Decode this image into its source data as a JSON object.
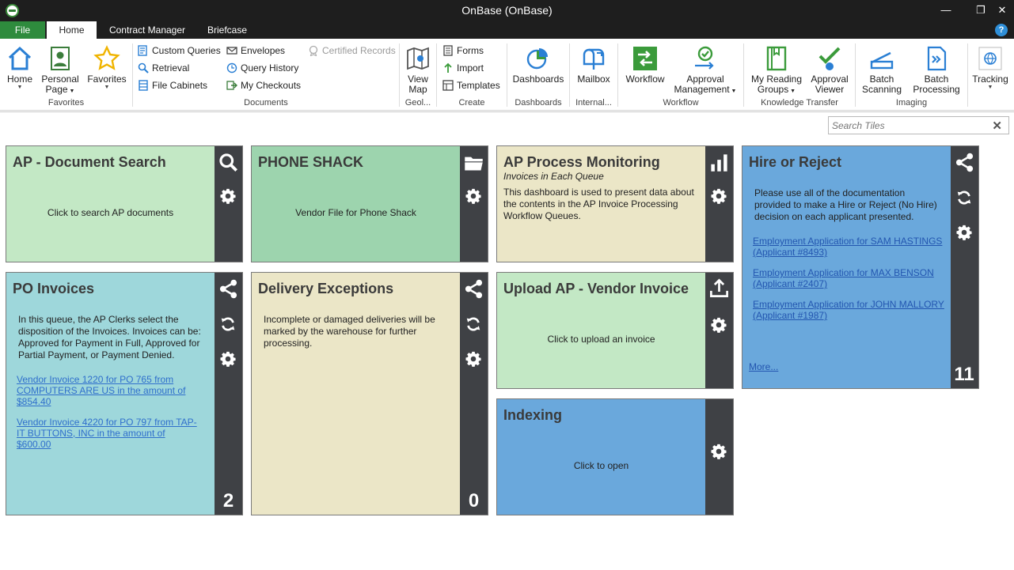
{
  "window": {
    "title": "OnBase (OnBase)",
    "minimize": "—",
    "restore": "❐",
    "close": "✕"
  },
  "tabs": {
    "file": "File",
    "home": "Home",
    "contract_manager": "Contract Manager",
    "briefcase": "Briefcase",
    "help": "?"
  },
  "ribbon": {
    "home": "Home",
    "personal_page": "Personal",
    "personal_page2": "Page",
    "favorites": "Favorites",
    "group_favorites": "Favorites",
    "custom_queries": "Custom Queries",
    "retrieval": "Retrieval",
    "file_cabinets": "File Cabinets",
    "envelopes": "Envelopes",
    "query_history": "Query History",
    "my_checkouts": "My Checkouts",
    "certified_records": "Certified Records",
    "group_documents": "Documents",
    "view_map": "View",
    "view_map2": "Map",
    "group_geo": "Geol...",
    "forms": "Forms",
    "import": "Import",
    "templates": "Templates",
    "group_create": "Create",
    "dashboards": "Dashboards",
    "group_dashboards": "Dashboards",
    "mailbox": "Mailbox",
    "group_internal": "Internal...",
    "workflow": "Workflow",
    "approval_mgmt": "Approval",
    "approval_mgmt2": "Management",
    "group_workflow": "Workflow",
    "my_reading_groups": "My Reading",
    "my_reading_groups2": "Groups",
    "approval_viewer": "Approval",
    "approval_viewer2": "Viewer",
    "group_knowledge": "Knowledge Transfer",
    "batch_scanning": "Batch",
    "batch_scanning2": "Scanning",
    "batch_processing": "Batch",
    "batch_processing2": "Processing",
    "group_imaging": "Imaging",
    "tracking": "Tracking"
  },
  "search": {
    "placeholder": "Search Tiles",
    "clear": "✕"
  },
  "tiles": {
    "ap_search": {
      "title": "AP - Document Search",
      "text": "Click to search AP documents",
      "color": "#c3e8c5"
    },
    "phone_shack": {
      "title": "PHONE SHACK",
      "text": "Vendor File for Phone Shack",
      "color": "#9dd4ae"
    },
    "ap_monitoring": {
      "title": "AP Process Monitoring",
      "subtitle": "Invoices in Each Queue",
      "text1": "This dashboard is used to present data about",
      "text2": "the contents in the AP Invoice Processing",
      "text3": "Workflow Queues.",
      "color": "#ebe6c7"
    },
    "hire_reject": {
      "title": "Hire or Reject",
      "text1": "Please use all of the documentation",
      "text2": "provided to make a Hire or Reject (No Hire)",
      "text3": "decision on each applicant presented.",
      "link1a": "Employment Application for SAM HASTINGS",
      "link1b": "(Applicant #8493)",
      "link2a": "Employment Application for MAX BENSON",
      "link2b": "(Applicant #2407)",
      "link3a": "Employment Application for JOHN MALLORY",
      "link3b": "(Applicant #1987)",
      "more": "More...",
      "count": "11",
      "color": "#6aa8dc"
    },
    "po_invoices": {
      "title": "PO Invoices",
      "text1": "In this queue, the AP Clerks select the",
      "text2": "disposition of the Invoices. Invoices can be:",
      "text3": "Approved for Payment in Full, Approved for",
      "text4": "Partial Payment, or Payment Denied.",
      "link1a": "Vendor Invoice 1220 for PO 765 from",
      "link1b": "COMPUTERS ARE US in the amount of",
      "link1c": "$854.40",
      "link2a": "Vendor Invoice 4220 for PO 797 from TAP-",
      "link2b": "IT BUTTONS, INC in the amount of",
      "link2c": "$600.00",
      "count": "2",
      "color": "#9ed7db"
    },
    "delivery_exceptions": {
      "title": "Delivery Exceptions",
      "text1": "Incomplete or damaged deliveries will be",
      "text2": "marked by the warehouse for further",
      "text3": "processing.",
      "count": "0",
      "color": "#ebe6c7"
    },
    "upload_ap": {
      "title": "Upload AP - Vendor Invoice",
      "text": "Click to upload an invoice",
      "color": "#c3e8c5"
    },
    "indexing": {
      "title": "Indexing",
      "text": "Click to open",
      "color": "#6aa8dc"
    }
  }
}
